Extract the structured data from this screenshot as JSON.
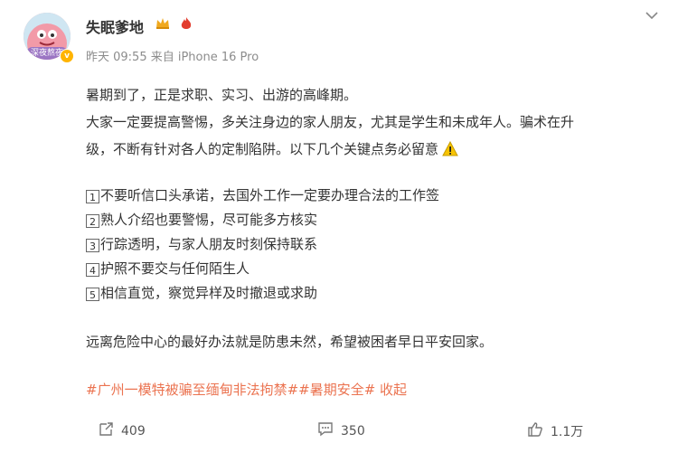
{
  "post": {
    "author": {
      "name": "失眠爹地",
      "avatar_badge": "深夜熬夜",
      "icons": [
        "crown-icon",
        "flame-icon"
      ]
    },
    "meta": "昨天 09:55  来自 iPhone 16 Pro",
    "lines": {
      "l1": "暑期到了，正是求职、实习、出游的高峰期。",
      "l2": "大家一定要提高警惕，多关注身边的家人朋友，尤其是学生和未成年人。骗术在升",
      "l3": "级，不断有针对各人的定制陷阱。以下几个关键点务必留意"
    },
    "tips": [
      {
        "num": "1",
        "text": "不要听信口头承诺，去国外工作一定要办理合法的工作签"
      },
      {
        "num": "2",
        "text": "熟人介绍也要警惕，尽可能多方核实"
      },
      {
        "num": "3",
        "text": "行踪透明，与家人朋友时刻保持联系"
      },
      {
        "num": "4",
        "text": "护照不要交与任何陌生人"
      },
      {
        "num": "5",
        "text": "相信直觉，察觉异样及时撤退或求助"
      }
    ],
    "closing": "远离危险中心的最好办法就是防患未然，希望被困者早日平安回家。",
    "hashtags_line": "#广州一模特被骗至缅甸非法拘禁##暑期安全# 收起",
    "actions": {
      "repost": "409",
      "comment": "350",
      "like": "1.1万"
    },
    "colors": {
      "hashtag": "#eb7350",
      "text": "#333333",
      "meta": "#8c8c8c"
    }
  }
}
